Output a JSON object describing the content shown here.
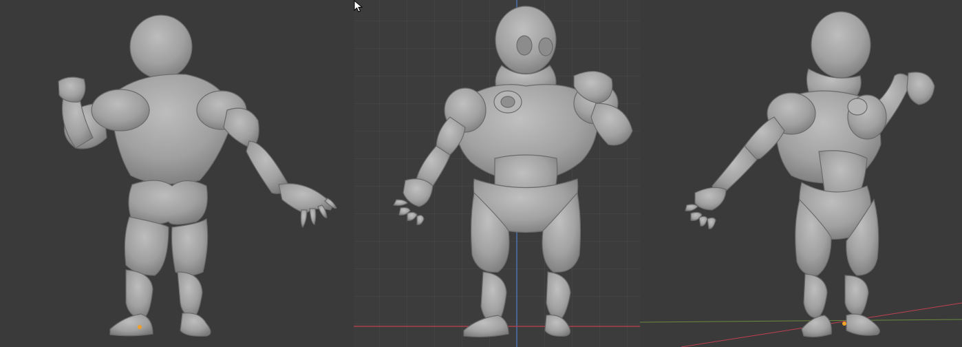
{
  "viewports": [
    {
      "id": "left",
      "view": "back"
    },
    {
      "id": "center",
      "view": "front-orthographic"
    },
    {
      "id": "right",
      "view": "three-quarter-perspective"
    }
  ],
  "icons": {
    "cursor": "mouse-pointer-icon",
    "origin": "object-origin-icon"
  },
  "colors": {
    "background": "#3a3a3a",
    "grid": "#4a4a4a",
    "model": "#a3a3a3",
    "x_axis": "#c2404f",
    "z_axis": "#4f7fd0",
    "y_axis_persp": "#6a8a3e",
    "origin_dot": "#f2a128"
  }
}
